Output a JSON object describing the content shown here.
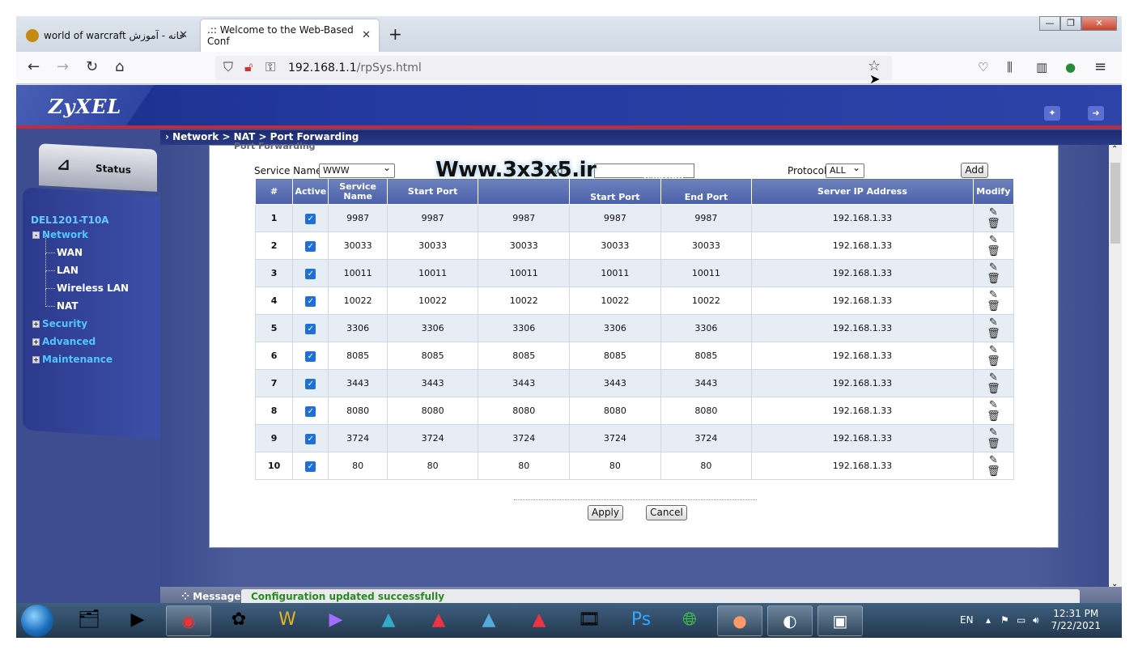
{
  "browser": {
    "tabs": [
      {
        "title": "world of warcraft خانه - آموزش",
        "favicon_color": "#c58a12",
        "active": false
      },
      {
        "title": ".:: Welcome to the Web-Based Conf",
        "favicon_color": "",
        "active": true
      }
    ],
    "new_tab_icon": "+",
    "url_host": "192.168.1.1",
    "url_path": "/rpSys.html",
    "window_controls": {
      "minimize": "—",
      "maximize": "❐",
      "close": "✕"
    }
  },
  "router": {
    "brand": "ZyXEL",
    "breadcrumb": "Network > NAT > Port Forwarding",
    "sidebar": {
      "status_label": "Status",
      "device_name": "DEL1201-T10A",
      "items": [
        {
          "label": "Network",
          "level": "top",
          "expander": "-"
        },
        {
          "label": "WAN",
          "level": "sub"
        },
        {
          "label": "LAN",
          "level": "sub"
        },
        {
          "label": "Wireless LAN",
          "level": "sub"
        },
        {
          "label": "NAT",
          "level": "sub"
        },
        {
          "label": "Security",
          "level": "top",
          "expander": "+"
        },
        {
          "label": "Advanced",
          "level": "top",
          "expander": "+"
        },
        {
          "label": "Maintenance",
          "level": "top",
          "expander": "+"
        }
      ]
    },
    "panel_title": "Port Forwarding",
    "controls": {
      "service_name_label": "Service Name",
      "service_name_value": "WWW",
      "address_field_fragment": "Ad",
      "protocol_label": "Protocol",
      "protocol_value": "ALL",
      "add_label": "Add"
    },
    "watermark": "Www.3x3x5.ir",
    "table": {
      "headers": [
        "#",
        "Active",
        "Service Name",
        "Start Port",
        "",
        "Start Port",
        "End Port",
        "Server IP Address",
        "Modify"
      ],
      "group_header_fragment": "nslation",
      "rows": [
        {
          "n": "1",
          "name": "9987",
          "start": "9987",
          "end": "9987",
          "tstart": "9987",
          "tend": "9987",
          "ip": "192.168.1.33"
        },
        {
          "n": "2",
          "name": "30033",
          "start": "30033",
          "end": "30033",
          "tstart": "30033",
          "tend": "30033",
          "ip": "192.168.1.33"
        },
        {
          "n": "3",
          "name": "10011",
          "start": "10011",
          "end": "10011",
          "tstart": "10011",
          "tend": "10011",
          "ip": "192.168.1.33"
        },
        {
          "n": "4",
          "name": "10022",
          "start": "10022",
          "end": "10022",
          "tstart": "10022",
          "tend": "10022",
          "ip": "192.168.1.33"
        },
        {
          "n": "5",
          "name": "3306",
          "start": "3306",
          "end": "3306",
          "tstart": "3306",
          "tend": "3306",
          "ip": "192.168.1.33"
        },
        {
          "n": "6",
          "name": "8085",
          "start": "8085",
          "end": "8085",
          "tstart": "8085",
          "tend": "8085",
          "ip": "192.168.1.33"
        },
        {
          "n": "7",
          "name": "3443",
          "start": "3443",
          "end": "3443",
          "tstart": "3443",
          "tend": "3443",
          "ip": "192.168.1.33"
        },
        {
          "n": "8",
          "name": "8080",
          "start": "8080",
          "end": "8080",
          "tstart": "8080",
          "tend": "8080",
          "ip": "192.168.1.33"
        },
        {
          "n": "9",
          "name": "3724",
          "start": "3724",
          "end": "3724",
          "tstart": "3724",
          "tend": "3724",
          "ip": "192.168.1.33"
        },
        {
          "n": "10",
          "name": "80",
          "start": "80",
          "end": "80",
          "tstart": "80",
          "tend": "80",
          "ip": "192.168.1.33"
        }
      ]
    },
    "apply_label": "Apply",
    "cancel_label": "Cancel",
    "message_label": "Message",
    "message_text": "Configuration updated successfully"
  },
  "taskbar": {
    "language": "EN",
    "time": "12:31 PM",
    "date": "7/22/2021"
  },
  "colors": {
    "header_blue": "#24399f",
    "accent_red": "#c42b3a",
    "menu_cyan": "#52c6ff",
    "message_green": "#2a8a1f",
    "table_header": "#5a6fb2"
  }
}
